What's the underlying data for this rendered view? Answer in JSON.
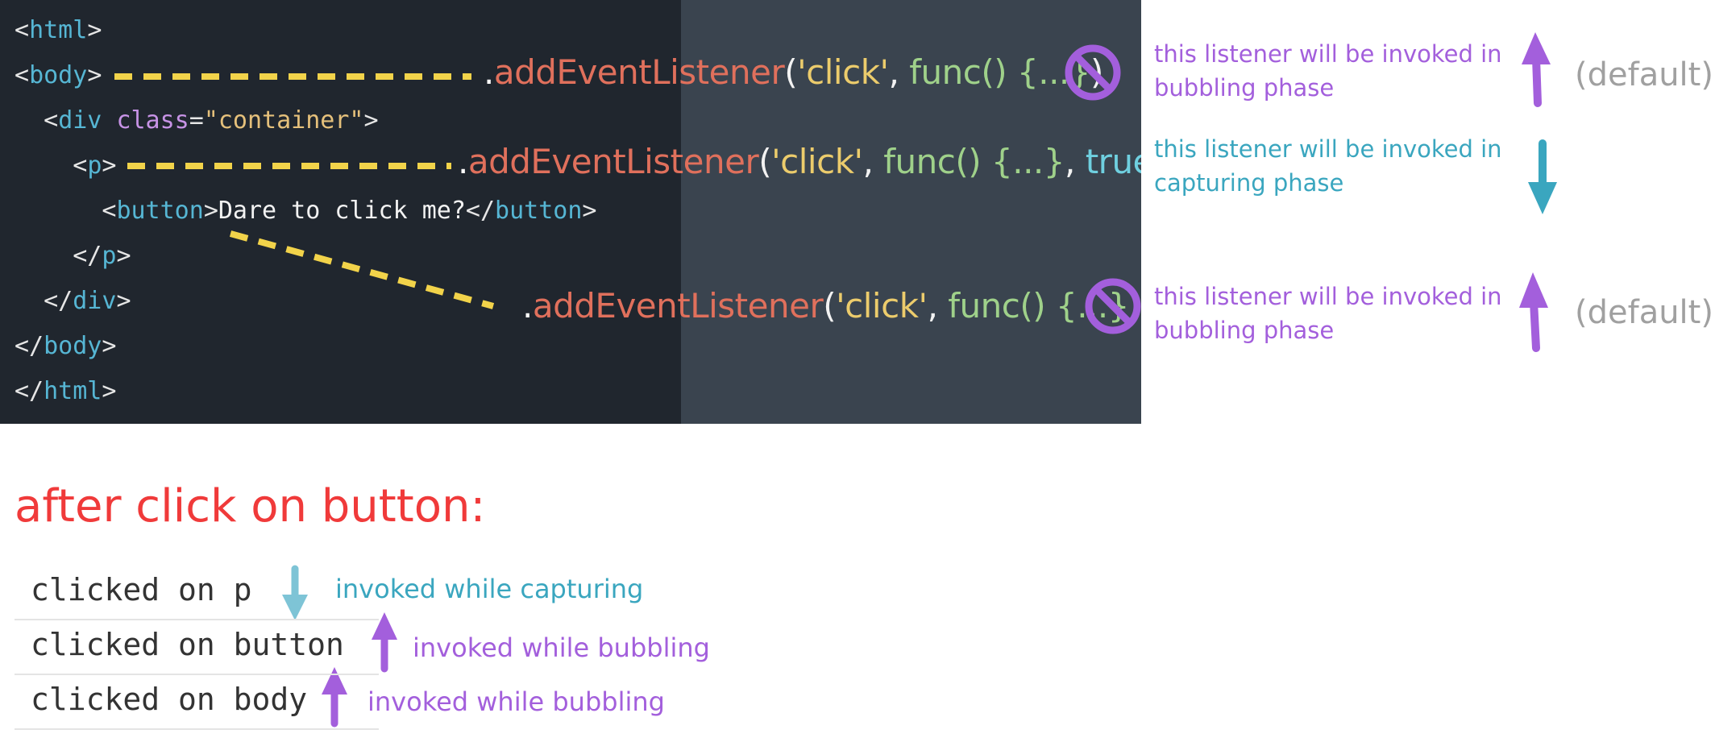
{
  "code": {
    "lines": [
      {
        "indent": "",
        "open": "<",
        "tag": "html",
        "close": ">"
      },
      {
        "indent": "",
        "open": "<",
        "tag": "body",
        "close": ">"
      },
      {
        "indent": "  ",
        "open": "<",
        "tag": "div",
        "space": " ",
        "attr": "class",
        "eq": "=",
        "val": "\"container\"",
        "close": ">"
      },
      {
        "indent": "    ",
        "open": "<",
        "tag": "p",
        "close": ">"
      },
      {
        "indent": "      ",
        "open": "<",
        "tag": "button",
        "close": ">",
        "text": "Dare to click me?",
        "endopen": "</",
        "endtag": "button",
        "endclose": ">"
      },
      {
        "indent": "    ",
        "open": "</",
        "tag": "p",
        "close": ">"
      },
      {
        "indent": "  ",
        "open": "</",
        "tag": "div",
        "close": ">"
      },
      {
        "indent": "",
        "open": "</",
        "tag": "body",
        "close": ">"
      },
      {
        "indent": "",
        "open": "</",
        "tag": "html",
        "close": ">"
      }
    ]
  },
  "listeners": [
    {
      "dot": ".",
      "method": "addEventListener",
      "paren_open": "(",
      "event": "'click'",
      "comma1": ", ",
      "func": "func() {...}",
      "comma2": "",
      "capture": "",
      "paren_close": ")"
    },
    {
      "dot": ".",
      "method": "addEventListener",
      "paren_open": "(",
      "event": "'click'",
      "comma1": ", ",
      "func": "func() {...}",
      "comma2": ", ",
      "capture": "true",
      "paren_close": ")"
    },
    {
      "dot": ".",
      "method": "addEventListener",
      "paren_open": "(",
      "event": "'click'",
      "comma1": ", ",
      "func": "func() {...}",
      "comma2": "",
      "capture": "",
      "paren_close": ")"
    }
  ],
  "annotations": [
    {
      "text": "this listener will be invoked in\nbubbling phase",
      "direction": "up",
      "default_label": "(default)"
    },
    {
      "text": "this listener will be invoked in\ncapturing phase",
      "direction": "down",
      "default_label": ""
    },
    {
      "text": "this listener will be invoked in\nbubbling phase",
      "direction": "up",
      "default_label": "(default)"
    }
  ],
  "result": {
    "heading": "after click on button:",
    "logs": [
      {
        "text": "clicked on p",
        "note": "invoked while capturing",
        "direction": "down"
      },
      {
        "text": "clicked on button",
        "note": "invoked while bubbling",
        "direction": "up"
      },
      {
        "text": "clicked on body",
        "note": "invoked while bubbling",
        "direction": "up"
      }
    ]
  },
  "colors": {
    "code_bg": "#20262e",
    "code_bg_right": "#3a444f",
    "bubbling": "#a35fdc",
    "capturing": "#3aa6bf",
    "heading": "#f03a3a",
    "dash": "#f2d34a"
  },
  "icons": [
    "no-entry-icon",
    "arrow-up-icon",
    "arrow-down-icon"
  ]
}
